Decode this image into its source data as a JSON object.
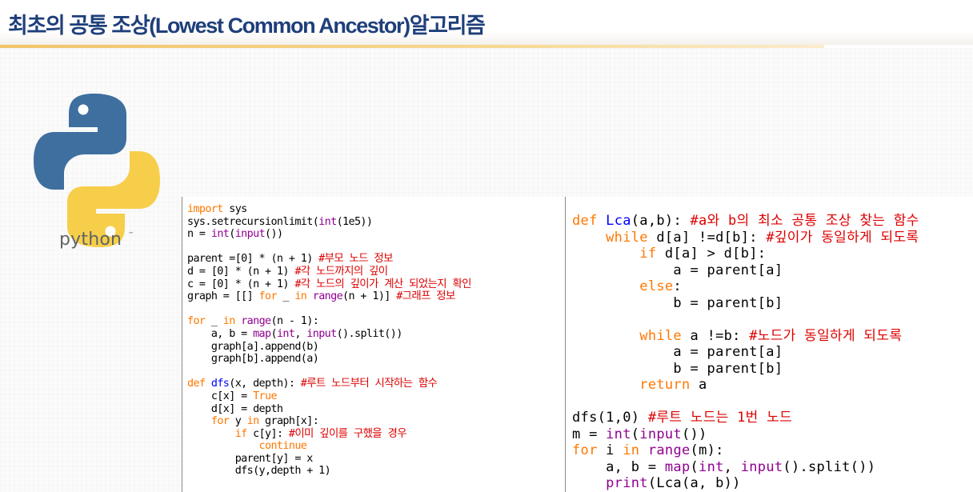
{
  "header": {
    "title": "최초의 공통 조상(Lowest Common Ancestor)알고리즘"
  },
  "logo": {
    "text": "python",
    "tm": "™",
    "colors": {
      "blue": "#3e6f9f",
      "yellow": "#f7ce49"
    }
  },
  "code_left": [
    [
      [
        "kw",
        "import"
      ],
      [
        "t",
        " sys"
      ]
    ],
    [
      [
        "t",
        "sys.setrecursionlimit("
      ],
      [
        "bi",
        "int"
      ],
      [
        "t",
        "(1e5))"
      ]
    ],
    [
      [
        "t",
        "n = "
      ],
      [
        "bi",
        "int"
      ],
      [
        "t",
        "("
      ],
      [
        "bi",
        "input"
      ],
      [
        "t",
        "())"
      ]
    ],
    [
      [
        "t",
        ""
      ]
    ],
    [
      [
        "t",
        "parent =[0] * (n + 1) "
      ],
      [
        "cm",
        "#부모 노드 정보"
      ]
    ],
    [
      [
        "t",
        "d = [0] * (n + 1) "
      ],
      [
        "cm",
        "#각 노드까지의 깊이"
      ]
    ],
    [
      [
        "t",
        "c = [0] * (n + 1) "
      ],
      [
        "cm",
        "#각 노드의 깊이가 계산 되었는지 확인"
      ]
    ],
    [
      [
        "t",
        "graph = [[] "
      ],
      [
        "kw",
        "for"
      ],
      [
        "t",
        " _ "
      ],
      [
        "kw",
        "in"
      ],
      [
        "t",
        " "
      ],
      [
        "bi",
        "range"
      ],
      [
        "t",
        "(n + 1)] "
      ],
      [
        "cm",
        "#그래프 정보"
      ]
    ],
    [
      [
        "t",
        ""
      ]
    ],
    [
      [
        "kw",
        "for"
      ],
      [
        "t",
        " _ "
      ],
      [
        "kw",
        "in"
      ],
      [
        "t",
        " "
      ],
      [
        "bi",
        "range"
      ],
      [
        "t",
        "(n - 1):"
      ]
    ],
    [
      [
        "t",
        "    a, b = "
      ],
      [
        "bi",
        "map"
      ],
      [
        "t",
        "("
      ],
      [
        "bi",
        "int"
      ],
      [
        "t",
        ", "
      ],
      [
        "bi",
        "input"
      ],
      [
        "t",
        "().split())"
      ]
    ],
    [
      [
        "t",
        "    graph[a].append(b)"
      ]
    ],
    [
      [
        "t",
        "    graph[b].append(a)"
      ]
    ],
    [
      [
        "t",
        ""
      ]
    ],
    [
      [
        "kw",
        "def"
      ],
      [
        "t",
        " "
      ],
      [
        "fn",
        "dfs"
      ],
      [
        "t",
        "(x, depth): "
      ],
      [
        "cm",
        "#루트 노드부터 시작하는 함수"
      ]
    ],
    [
      [
        "t",
        "    c[x] = "
      ],
      [
        "kw",
        "True"
      ]
    ],
    [
      [
        "t",
        "    d[x] = depth"
      ]
    ],
    [
      [
        "t",
        "    "
      ],
      [
        "kw",
        "for"
      ],
      [
        "t",
        " y "
      ],
      [
        "kw",
        "in"
      ],
      [
        "t",
        " graph[x]:"
      ]
    ],
    [
      [
        "t",
        "        "
      ],
      [
        "kw",
        "if"
      ],
      [
        "t",
        " c[y]: "
      ],
      [
        "cm",
        "#이미 깊이를 구했을 경우"
      ]
    ],
    [
      [
        "t",
        "            "
      ],
      [
        "kw",
        "continue"
      ]
    ],
    [
      [
        "t",
        "        parent[y] = x"
      ]
    ],
    [
      [
        "t",
        "        dfs(y,depth + 1)"
      ]
    ]
  ],
  "code_right": [
    [
      [
        "kw",
        "def"
      ],
      [
        "t",
        " "
      ],
      [
        "fn",
        "Lca"
      ],
      [
        "t",
        "(a,b): "
      ],
      [
        "cm",
        "#a와 b의 최소 공통 조상 찾는 함수"
      ]
    ],
    [
      [
        "t",
        "    "
      ],
      [
        "kw",
        "while"
      ],
      [
        "t",
        " d[a] !=d[b]: "
      ],
      [
        "cm",
        "#깊이가 동일하게 되도록"
      ]
    ],
    [
      [
        "t",
        "        "
      ],
      [
        "kw",
        "if"
      ],
      [
        "t",
        " d[a] > d[b]:"
      ]
    ],
    [
      [
        "t",
        "            a = parent[a]"
      ]
    ],
    [
      [
        "t",
        "        "
      ],
      [
        "kw",
        "else"
      ],
      [
        "t",
        ":"
      ]
    ],
    [
      [
        "t",
        "            b = parent[b]"
      ]
    ],
    [
      [
        "t",
        ""
      ]
    ],
    [
      [
        "t",
        "        "
      ],
      [
        "kw",
        "while"
      ],
      [
        "t",
        " a !=b: "
      ],
      [
        "cm",
        "#노드가 동일하게 되도록"
      ]
    ],
    [
      [
        "t",
        "            a = parent[a]"
      ]
    ],
    [
      [
        "t",
        "            b = parent[b]"
      ]
    ],
    [
      [
        "t",
        "        "
      ],
      [
        "kw",
        "return"
      ],
      [
        "t",
        " a"
      ]
    ],
    [
      [
        "t",
        ""
      ]
    ],
    [
      [
        "t",
        "dfs(1,0) "
      ],
      [
        "cm",
        "#루트 노드는 1번 노드"
      ]
    ],
    [
      [
        "t",
        "m = "
      ],
      [
        "bi",
        "int"
      ],
      [
        "t",
        "("
      ],
      [
        "bi",
        "input"
      ],
      [
        "t",
        "())"
      ]
    ],
    [
      [
        "kw",
        "for"
      ],
      [
        "t",
        " i "
      ],
      [
        "kw",
        "in"
      ],
      [
        "t",
        " "
      ],
      [
        "bi",
        "range"
      ],
      [
        "t",
        "(m):"
      ]
    ],
    [
      [
        "t",
        "    a, b = "
      ],
      [
        "bi",
        "map"
      ],
      [
        "t",
        "("
      ],
      [
        "bi",
        "int"
      ],
      [
        "t",
        ", "
      ],
      [
        "bi",
        "input"
      ],
      [
        "t",
        "().split())"
      ]
    ],
    [
      [
        "t",
        "    "
      ],
      [
        "bi",
        "print"
      ],
      [
        "t",
        "(Lca(a, b))"
      ]
    ]
  ]
}
